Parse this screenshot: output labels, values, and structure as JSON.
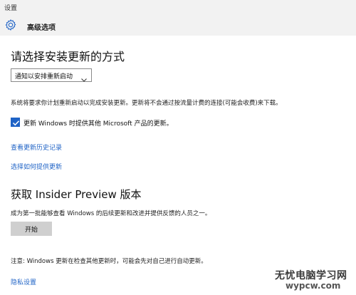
{
  "window": {
    "title": "设置"
  },
  "header": {
    "title": "高级选项",
    "icon": "gear-icon"
  },
  "section_update": {
    "heading": "请选择安装更新的方式",
    "dropdown_value": "通知以安排重新启动",
    "info_text": "系统将要求你计划重新启动以完成安装更新。更新将不会通过按流量计费的连接(可能会收费)来下载。",
    "checkbox_label": "更新 Windows 时提供其他 Microsoft 产品的更新。",
    "checkbox_checked": true,
    "link_history": "查看更新历史记录",
    "link_delivery": "选择如何提供更新"
  },
  "section_insider": {
    "heading": "获取 Insider Preview 版本",
    "description": "成为第一批能够查看 Windows 的后续更新和改进并提供反馈的人员之一。",
    "start_button": "开始",
    "note": "注意: Windows 更新在检查其他更新时，可能会先对自己进行自动更新。",
    "privacy_link": "隐私设置"
  },
  "watermark": {
    "line1": "无忧电脑学习网",
    "line2": "wypcw.com"
  },
  "colors": {
    "accent": "#1f63c6",
    "header_bg": "#f2f2f2",
    "button_bg": "#cfcfcf"
  }
}
